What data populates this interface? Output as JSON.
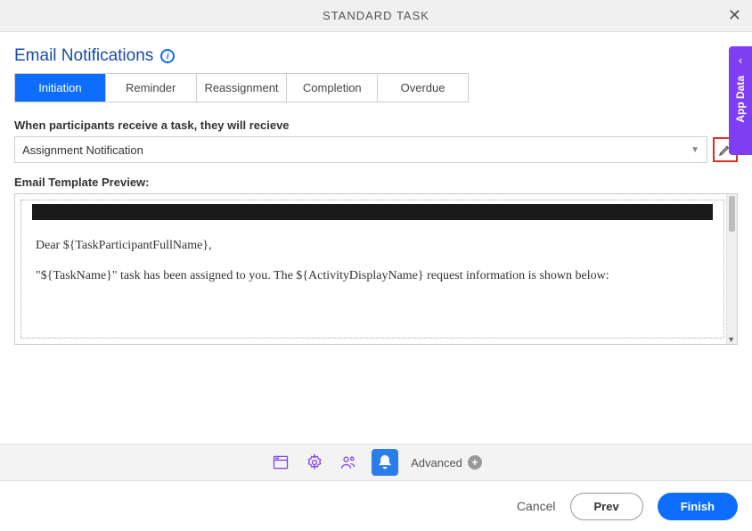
{
  "header": {
    "title": "STANDARD TASK"
  },
  "section": {
    "title": "Email Notifications"
  },
  "tabs": [
    "Initiation",
    "Reminder",
    "Reassignment",
    "Completion",
    "Overdue"
  ],
  "active_tab_index": 0,
  "field": {
    "label": "When participants receive a task, they will recieve",
    "selected": "Assignment Notification"
  },
  "preview_label": "Email Template Preview:",
  "preview": {
    "line1": "Dear ${TaskParticipantFullName},",
    "line2": "\"${TaskName}\" task has been assigned to you. The ${ActivityDisplayName} request information is shown below:"
  },
  "side_tab": "App Data",
  "toolbar": {
    "advanced_label": "Advanced"
  },
  "footer": {
    "cancel": "Cancel",
    "prev": "Prev",
    "finish": "Finish"
  }
}
